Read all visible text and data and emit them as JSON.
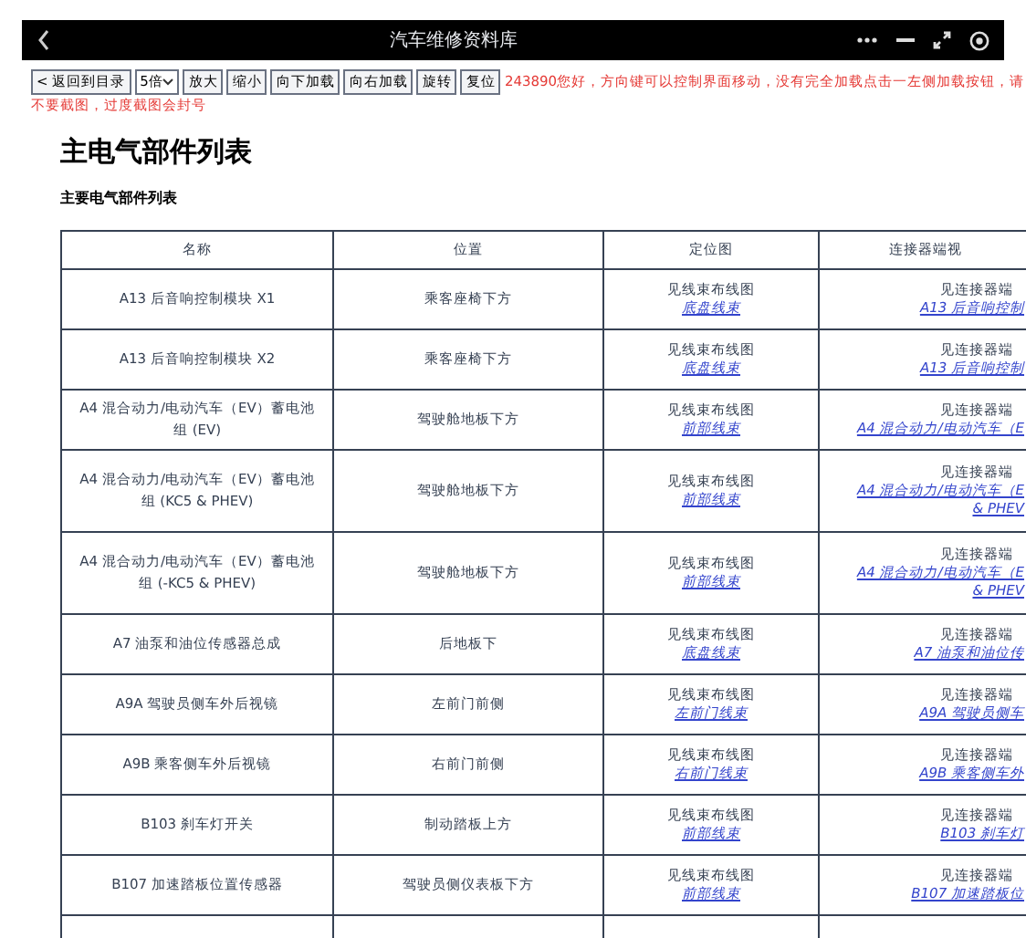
{
  "window": {
    "title": "汽车维修资料库"
  },
  "toolbar": {
    "back": "< 返回到目录",
    "zoom_select": "5倍",
    "buttons": [
      "放大",
      "缩小",
      "向下加载",
      "向右加载",
      "旋转",
      "复位"
    ],
    "notice_lines": [
      "243890您好，方向键可以控制界面移动，没有完全加载点击一左侧加载按钮，请",
      "不要截图，过度截图会封号"
    ]
  },
  "heading": "主电气部件列表",
  "subheading": "主要电气部件列表",
  "table": {
    "columns": [
      "名称",
      "位置",
      "定位图",
      "连接器端视"
    ],
    "rows": [
      {
        "name": "A13 后音响控制模块 X1",
        "location": "乘客座椅下方",
        "locator_text": "见线束布线图",
        "locator_link": "底盘线束",
        "connector_text": "见连接器端",
        "connector_link": [
          "A13 后音响控制"
        ]
      },
      {
        "name": "A13 后音响控制模块 X2",
        "location": "乘客座椅下方",
        "locator_text": "见线束布线图",
        "locator_link": "底盘线束",
        "connector_text": "见连接器端",
        "connector_link": [
          "A13 后音响控制"
        ]
      },
      {
        "name": "A4 混合动力/电动汽车（EV）蓄电池组 (EV)",
        "location": "驾驶舱地板下方",
        "locator_text": "见线束布线图",
        "locator_link": "前部线束",
        "connector_text": "见连接器端",
        "connector_link": [
          "A4 混合动力/电动汽车（E"
        ]
      },
      {
        "name": "A4 混合动力/电动汽车（EV）蓄电池组 (KC5 & PHEV)",
        "location": "驾驶舱地板下方",
        "locator_text": "见线束布线图",
        "locator_link": "前部线束",
        "connector_text": "见连接器端",
        "connector_link": [
          "A4 混合动力/电动汽车（E",
          "& PHEV"
        ]
      },
      {
        "name": "A4 混合动力/电动汽车（EV）蓄电池组 (-KC5 & PHEV)",
        "location": "驾驶舱地板下方",
        "locator_text": "见线束布线图",
        "locator_link": "前部线束",
        "connector_text": "见连接器端",
        "connector_link": [
          "A4 混合动力/电动汽车（E",
          "& PHEV"
        ]
      },
      {
        "name": "A7 油泵和油位传感器总成",
        "location": "后地板下",
        "locator_text": "见线束布线图",
        "locator_link": "底盘线束",
        "connector_text": "见连接器端",
        "connector_link": [
          "A7 油泵和油位传"
        ]
      },
      {
        "name": "A9A 驾驶员侧车外后视镜",
        "location": "左前门前侧",
        "locator_text": "见线束布线图",
        "locator_link": "左前门线束",
        "connector_text": "见连接器端",
        "connector_link": [
          "A9A 驾驶员侧车"
        ]
      },
      {
        "name": "A9B 乘客侧车外后视镜",
        "location": "右前门前侧",
        "locator_text": "见线束布线图",
        "locator_link": "右前门线束",
        "connector_text": "见连接器端",
        "connector_link": [
          "A9B 乘客侧车外"
        ]
      },
      {
        "name": "B103 刹车灯开关",
        "location": "制动踏板上方",
        "locator_text": "见线束布线图",
        "locator_link": "前部线束",
        "connector_text": "见连接器端",
        "connector_link": [
          "B103 刹车灯"
        ]
      },
      {
        "name": "B107 加速踏板位置传感器",
        "location": "驾驶员侧仪表板下方",
        "locator_text": "见线束布线图",
        "locator_link": "前部线束",
        "connector_text": "见连接器端",
        "connector_link": [
          "B107 加速踏板位"
        ]
      }
    ]
  }
}
